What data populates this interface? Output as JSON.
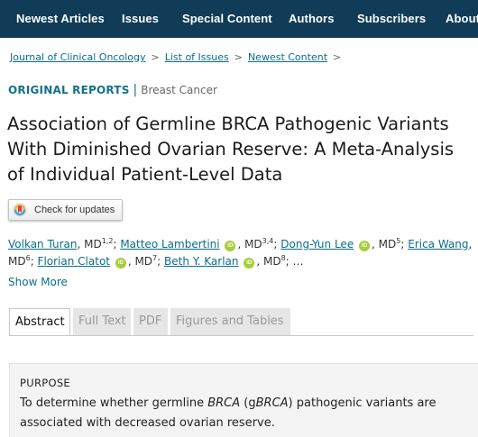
{
  "nav": {
    "items": [
      "Newest Articles",
      "Issues",
      "Special Content",
      "Authors",
      "Subscribers",
      "About"
    ]
  },
  "breadcrumb": {
    "items": [
      "Journal of Clinical Oncology",
      "List of Issues",
      "Newest Content"
    ],
    "separator": ">"
  },
  "article": {
    "type": "ORIGINAL REPORTS",
    "divider": "|",
    "topic": "Breast Cancer",
    "title": "Association of Germline BRCA Pathogenic Variants With Diminished Ovarian Reserve: A Meta-Analysis of Individual Patient-Level Data",
    "check_updates_label": "Check for updates",
    "authors": [
      {
        "name": "Volkan Turan",
        "degree": "MD",
        "aff": "1,2",
        "orcid": false
      },
      {
        "name": "Matteo Lambertini",
        "degree": "MD",
        "aff": "3,4",
        "orcid": true
      },
      {
        "name": "Dong-Yun Lee",
        "degree": "MD",
        "aff": "5",
        "orcid": true
      },
      {
        "name": "Erica Wang",
        "degree": "MD",
        "aff": "6",
        "orcid": false
      },
      {
        "name": "Florian Clatot",
        "degree": "MD",
        "aff": "7",
        "orcid": true
      },
      {
        "name": "Beth Y. Karlan",
        "degree": "MD",
        "aff": "8",
        "orcid": true
      }
    ],
    "orcid_icon_text": "iD",
    "authors_ellipsis": "…",
    "show_more": "Show More"
  },
  "tabs": [
    "Abstract",
    "Full Text",
    "PDF",
    "Figures and Tables"
  ],
  "abstract": {
    "heading": "PURPOSE",
    "text_before": "To determine whether germline ",
    "text_brca": "BRCA",
    "text_middle": " (g",
    "text_brca2": "BRCA",
    "text_after": ") pathogenic variants are associated with decreased ovarian reserve."
  },
  "colors": {
    "nav_bg": "#113c58",
    "link": "#0a6d8c",
    "accent": "#14718a",
    "orcid": "#a6ce39",
    "abstract_bg": "#f4f4f4"
  }
}
